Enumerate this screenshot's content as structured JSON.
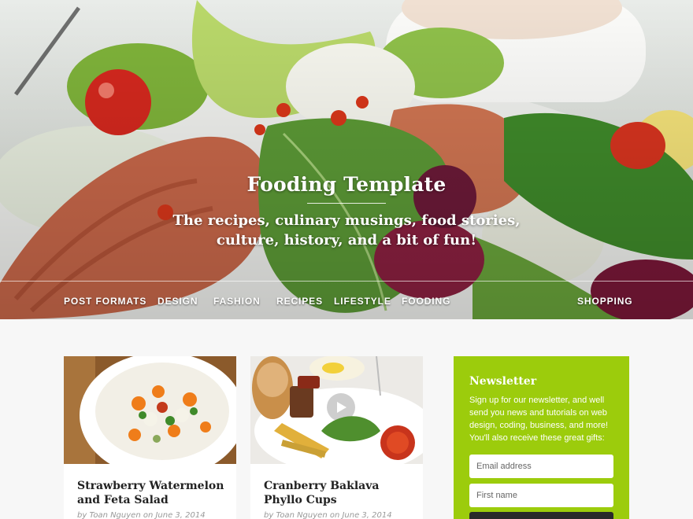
{
  "site": {
    "title": "Fooding Template",
    "tagline_line1": "The recipes, culinary musings, food stories,",
    "tagline_line2": "culture, history, and a bit of fun!"
  },
  "nav": {
    "items": [
      {
        "label": "POST FORMATS"
      },
      {
        "label": "DESIGN"
      },
      {
        "label": "FASHION"
      },
      {
        "label": "RECIPES"
      },
      {
        "label": "LIFESTYLE"
      },
      {
        "label": "FOODING"
      },
      {
        "label": "SHOPPING"
      }
    ]
  },
  "posts": [
    {
      "title": "Strawberry Watermelon and Feta Salad",
      "meta": "by Toan Nguyen on June 3, 2014"
    },
    {
      "title": "Cranberry Baklava Phyllo Cups",
      "meta": "by Toan Nguyen on June 3, 2014"
    }
  ],
  "newsletter": {
    "heading": "Newsletter",
    "description": "Sign up for our newsletter, and well send you news and tutorials on web design, coding, business, and more! You'll also receive these great gifts:",
    "email_placeholder": "Email address",
    "firstname_placeholder": "First name",
    "accent_color": "#9ccc0c"
  }
}
